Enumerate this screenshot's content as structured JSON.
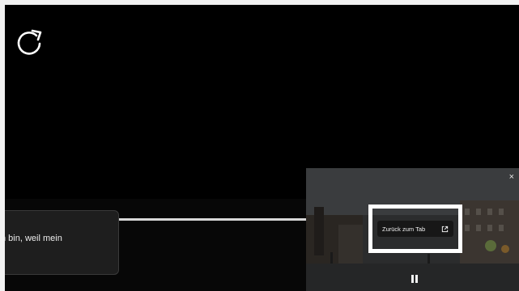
{
  "player": {
    "reload_icon": "reload-icon",
    "subtitle": "n bin, weil mein"
  },
  "pip": {
    "close_label": "×",
    "back_to_tab_label": "Zurück zum Tab",
    "open_icon": "open-in-new-icon",
    "pause_icon": "pause-icon",
    "highlight_color": "#ffffff"
  }
}
